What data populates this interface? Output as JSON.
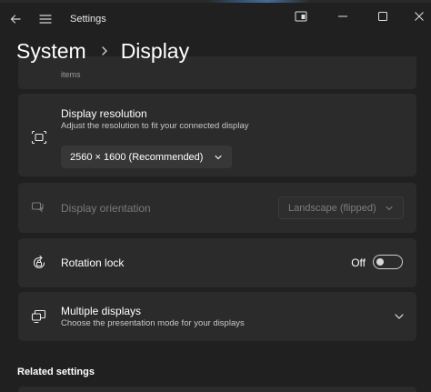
{
  "window": {
    "app_title": "Settings"
  },
  "titlebar": {
    "back_icon": "back-arrow-icon",
    "menu_icon": "hamburger-menu-icon",
    "snap_icon": "snap-layout-icon",
    "minimize_icon": "minimize-icon",
    "maximize_icon": "maximize-icon",
    "close_icon": "close-icon"
  },
  "breadcrumb": {
    "parent": "System",
    "current": "Display"
  },
  "cards": {
    "clipped_text": "items",
    "resolution": {
      "title": "Display resolution",
      "subtitle": "Adjust the resolution to fit your connected display",
      "value": "2560 × 1600 (Recommended)",
      "icon": "display-resolution-icon"
    },
    "orientation": {
      "title": "Display orientation",
      "value": "Landscape (flipped)",
      "disabled": true,
      "icon": "display-orientation-icon"
    },
    "rotation_lock": {
      "title": "Rotation lock",
      "state_label": "Off",
      "on": false,
      "icon": "rotation-lock-icon"
    },
    "multiple_displays": {
      "title": "Multiple displays",
      "subtitle": "Choose the presentation mode for your displays",
      "icon": "multiple-displays-icon"
    }
  },
  "sections": {
    "related_settings": "Related settings"
  },
  "colors": {
    "background": "#202020",
    "card": "#2b2b2b",
    "dropdown": "#373737",
    "text_primary": "#ffffff",
    "text_secondary": "#c8c8c8",
    "text_disabled": "#7a7a7a"
  }
}
